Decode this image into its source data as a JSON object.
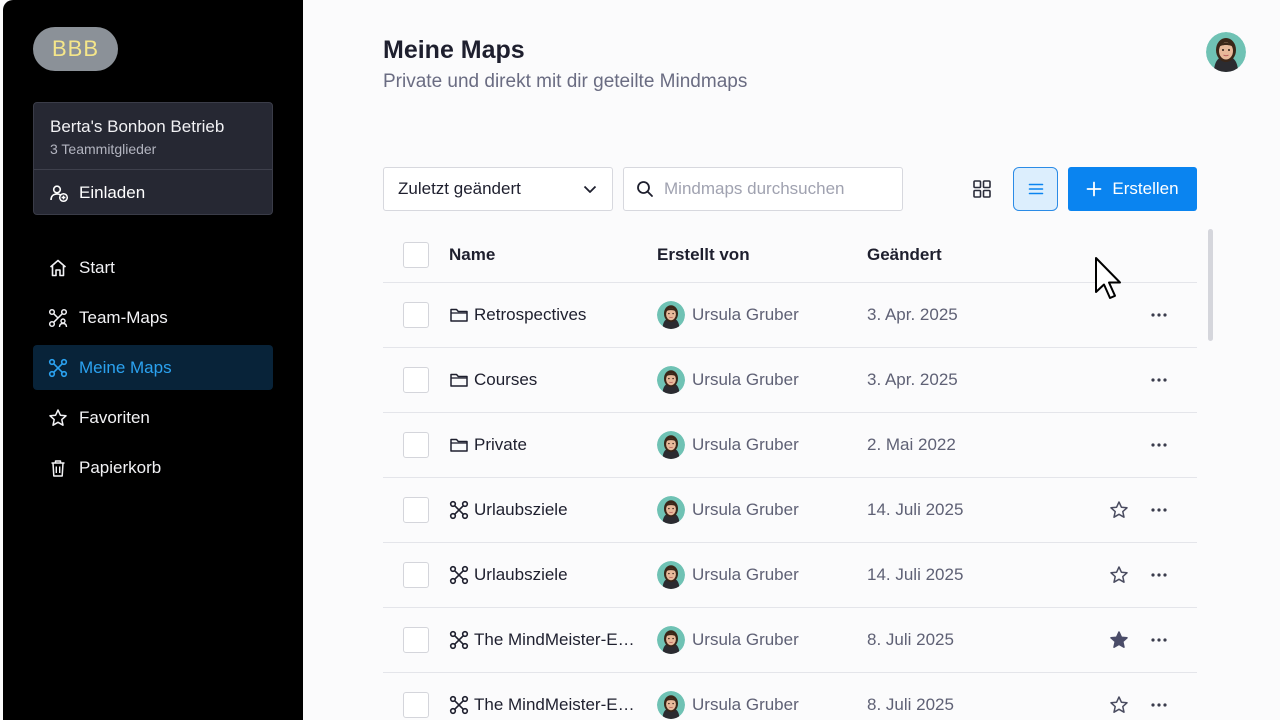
{
  "sidebar": {
    "logo_text": "BBB",
    "team_name": "Berta's Bonbon Betrieb",
    "team_members": "3 Teammitglieder",
    "invite_label": "Einladen",
    "nav": [
      {
        "label": "Start",
        "icon": "home-icon"
      },
      {
        "label": "Team-Maps",
        "icon": "team-maps-icon"
      },
      {
        "label": "Meine Maps",
        "icon": "mindmap-icon",
        "active": true
      },
      {
        "label": "Favoriten",
        "icon": "star-icon"
      },
      {
        "label": "Papierkorb",
        "icon": "trash-icon"
      }
    ]
  },
  "header": {
    "title": "Meine Maps",
    "subtitle": "Private und direkt mit dir geteilte Mindmaps"
  },
  "toolbar": {
    "sort_value": "Zuletzt geändert",
    "search_placeholder": "Mindmaps durchsuchen",
    "create_label": "Erstellen"
  },
  "table": {
    "columns": {
      "name": "Name",
      "creator": "Erstellt von",
      "changed": "Geändert"
    },
    "rows": [
      {
        "name": "Retrospectives",
        "type": "folder",
        "creator": "Ursula Gruber",
        "changed": "3. Apr. 2025",
        "star": "none"
      },
      {
        "name": "Courses",
        "type": "folder",
        "creator": "Ursula Gruber",
        "changed": "3. Apr. 2025",
        "star": "none"
      },
      {
        "name": "Private",
        "type": "folder",
        "creator": "Ursula Gruber",
        "changed": "2. Mai 2022",
        "star": "none"
      },
      {
        "name": "Urlaubsziele",
        "type": "map",
        "creator": "Ursula Gruber",
        "changed": "14. Juli 2025",
        "star": "outline"
      },
      {
        "name": "Urlaubsziele",
        "type": "map",
        "creator": "Ursula Gruber",
        "changed": "14. Juli 2025",
        "star": "outline"
      },
      {
        "name": "The MindMeister-E…",
        "type": "map",
        "creator": "Ursula Gruber",
        "changed": "8. Juli 2025",
        "star": "filled"
      },
      {
        "name": "The MindMeister-E…",
        "type": "map",
        "creator": "Ursula Gruber",
        "changed": "8. Juli 2025",
        "star": "outline"
      }
    ]
  },
  "colors": {
    "accent": "#0a84f0",
    "sidebar_bg": "#000000",
    "active_nav_bg": "#082339",
    "active_nav_text": "#2ba2f0"
  }
}
